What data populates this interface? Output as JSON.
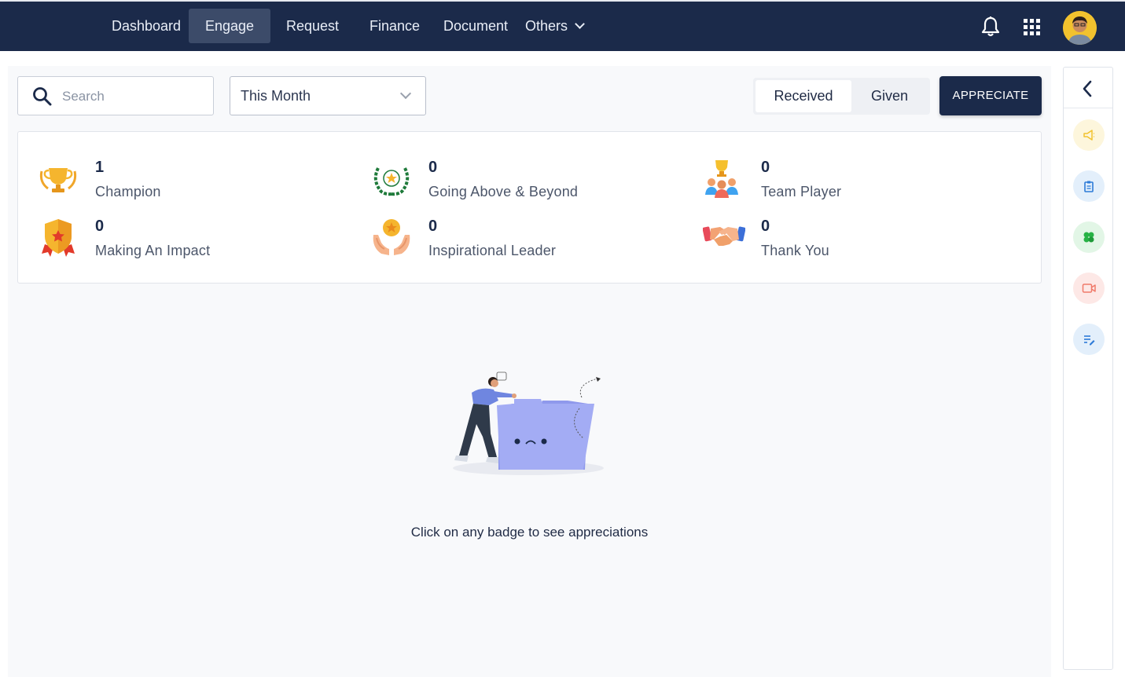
{
  "nav": {
    "items": [
      {
        "label": "Dashboard"
      },
      {
        "label": "Engage"
      },
      {
        "label": "Request"
      },
      {
        "label": "Finance"
      },
      {
        "label": "Document"
      },
      {
        "label": "Others"
      }
    ],
    "active": "Engage"
  },
  "header": {
    "icons": [
      "bell-icon",
      "apps-grid-icon",
      "user-avatar"
    ]
  },
  "toolbar": {
    "search_placeholder": "Search",
    "period_value": "This Month",
    "toggle": [
      "Received",
      "Given"
    ],
    "toggle_selected": "Received",
    "appreciate_label": "APPRECIATE"
  },
  "badges": [
    {
      "count": "1",
      "label": "Champion",
      "icon": "trophy-laurel-icon"
    },
    {
      "count": "0",
      "label": "Going Above & Beyond",
      "icon": "laurel-wreath-icon"
    },
    {
      "count": "0",
      "label": "Team Player",
      "icon": "team-trophy-icon"
    },
    {
      "count": "0",
      "label": "Making An Impact",
      "icon": "shield-medal-icon"
    },
    {
      "count": "0",
      "label": "Inspirational Leader",
      "icon": "hands-star-icon"
    },
    {
      "count": "0",
      "label": "Thank You",
      "icon": "handshake-icon"
    }
  ],
  "empty_state": {
    "message": "Click on any badge to see appreciations",
    "illustration": "empty-folder-illustration"
  },
  "right_sidebar": {
    "icons": [
      "chevron-left-icon",
      "megaphone-icon",
      "clipboard-icon",
      "clover-icon",
      "video-icon",
      "edit-list-icon"
    ],
    "colors": [
      "#fdf6dc",
      "#e3effb",
      "#e2f6e6",
      "#fde8e6",
      "#e3effb"
    ]
  },
  "colors": {
    "navbar": "#1b2a4a",
    "accent": "#1b2a4a",
    "page_bg": "#f8f9fb"
  }
}
